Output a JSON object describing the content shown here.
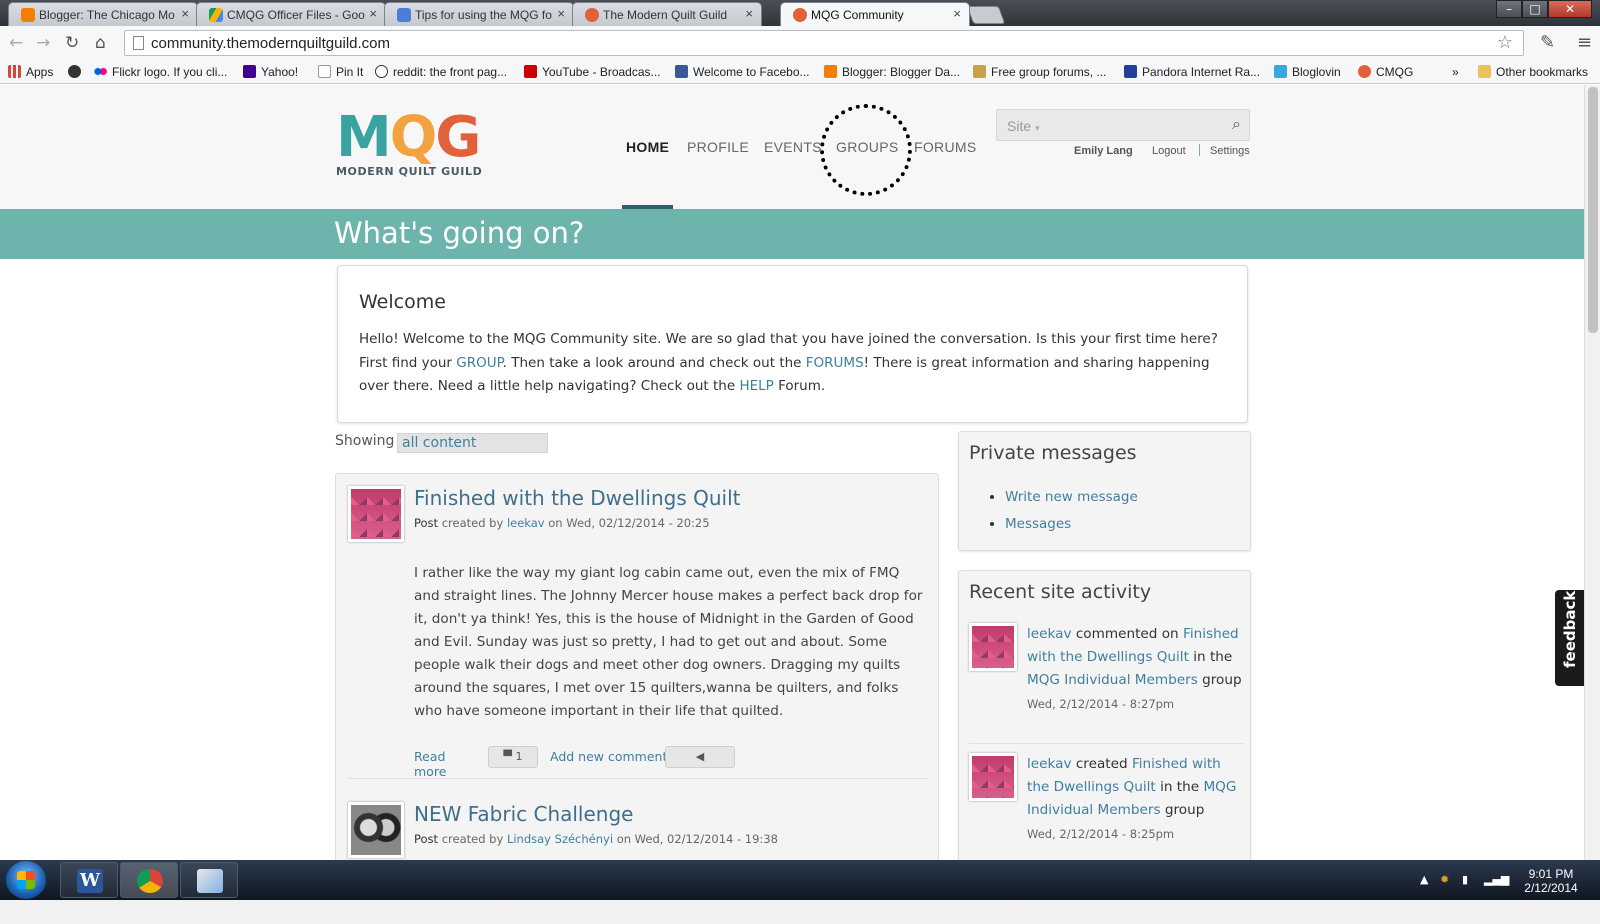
{
  "browser": {
    "tabs": [
      {
        "label": "Blogger: The Chicago Mo",
        "favicon_color": "#f57d00"
      },
      {
        "label": "CMQG Officer Files - Goo",
        "favicon_color": "#4285f4"
      },
      {
        "label": "Tips for using the MQG fo",
        "favicon_color": "#4a7fd6"
      },
      {
        "label": "The Modern Quilt Guild",
        "favicon_color": "#e2603a"
      },
      {
        "label": "MQG Community",
        "favicon_color": "#e2603a"
      }
    ],
    "url": "community.themodernquiltguild.com",
    "bookmarks": [
      {
        "label": "Apps",
        "icon_color": "#4285f4"
      },
      {
        "label": "",
        "icon_color": "#333333"
      },
      {
        "label": "Flickr logo. If you cli...",
        "icon_color": "#ff0084"
      },
      {
        "label": "Yahoo!",
        "icon_color": "#400090"
      },
      {
        "label": "Pin It",
        "icon_color": "#ffffff"
      },
      {
        "label": "reddit: the front pag...",
        "icon_color": "#ff4500"
      },
      {
        "label": "YouTube - Broadcas...",
        "icon_color": "#cc0000"
      },
      {
        "label": "Welcome to Facebo...",
        "icon_color": "#3b5998"
      },
      {
        "label": "Blogger: Blogger Da...",
        "icon_color": "#f57d00"
      },
      {
        "label": "Free group forums, ...",
        "icon_color": "#c8a24a"
      },
      {
        "label": "Pandora Internet Ra...",
        "icon_color": "#224099"
      },
      {
        "label": "Bloglovin",
        "icon_color": "#3ba5e0"
      },
      {
        "label": "CMQG",
        "icon_color": "#e2603a"
      },
      {
        "label": "»",
        "icon_color": ""
      },
      {
        "label": "Other bookmarks",
        "icon_color": "#e8c25a"
      }
    ]
  },
  "site": {
    "logo": {
      "letters": [
        "M",
        "Q",
        "G"
      ],
      "subtitle": "MODERN QUILT GUILD"
    },
    "nav": [
      "HOME",
      "PROFILE",
      "EVENTS",
      "GROUPS",
      "FORUMS"
    ],
    "search_placeholder": "Site",
    "search_dropdown": "▾",
    "user": {
      "name": "Emily Lang",
      "logout": "Logout",
      "settings": "Settings"
    },
    "banner_title": "What's going on?",
    "welcome": {
      "title": "Welcome",
      "text_1": "Hello! Welcome to the MQG Community site. We are so glad that you have joined the conversation. Is this your first time here? First find your ",
      "link_group": "GROUP",
      "text_2": ". Then take a look around and check out the ",
      "link_forums": "FORUMS",
      "text_3": "! There is great information and sharing happening over there. Need a little help navigating? Check out the ",
      "link_help": "HELP",
      "text_4": " Forum."
    },
    "showing_label": "Showing",
    "showing_value": "all content",
    "posts": [
      {
        "title": "Finished with the Dwellings Quilt",
        "type": "Post",
        "created_by": "created by",
        "author": "leekav",
        "on": "on Wed, 02/12/2014 - 20:25",
        "body": "I rather like the way my giant log cabin came out, even the mix of FMQ and straight lines.  The Johnny Mercer house makes a perfect back drop for it, don't ya think!  Yes, this is the house of Midnight in the Garden of Good and Evil.  Sunday was just so pretty, I had to get out and about.  Some people walk their dogs and meet other dog owners.  Dragging my quilts around the squares, I met over 15 quilters,wanna be quilters, and folks who have someone important in their life that quilted.",
        "read_more": "Read more",
        "comment_count": "1",
        "add_comment": "Add new comment"
      },
      {
        "title": "NEW Fabric Challenge",
        "type": "Post",
        "created_by": "created by",
        "author": "Lindsay Széchényi",
        "on": "on Wed, 02/12/2014 - 19:38"
      }
    ],
    "private_messages": {
      "title": "Private messages",
      "items": [
        "Write new message",
        "Messages"
      ]
    },
    "recent_activity": {
      "title": "Recent site activity",
      "items": [
        {
          "user": "leekav",
          "verb": " commented on ",
          "target": "Finished with the Dwellings Quilt",
          "mid": " in the ",
          "group": "MQG Individual Members",
          "tail": " group",
          "time": "Wed, 2/12/2014 - 8:27pm"
        },
        {
          "user": "leekav",
          "verb": " created ",
          "target": "Finished with the Dwellings Quilt",
          "mid": " in the ",
          "group": "MQG Individual Members",
          "tail": " group",
          "time": "Wed, 2/12/2014 - 8:25pm"
        }
      ]
    },
    "feedback_label": "feedback"
  },
  "taskbar": {
    "apps": [
      {
        "name": "Word",
        "letter": "W",
        "color": "#2b579a"
      },
      {
        "name": "Chrome",
        "letter": "",
        "color": "#db4437"
      },
      {
        "name": "Paint",
        "letter": "",
        "color": "#7fb2e5"
      }
    ],
    "time": "9:01 PM",
    "date": "2/12/2014"
  }
}
